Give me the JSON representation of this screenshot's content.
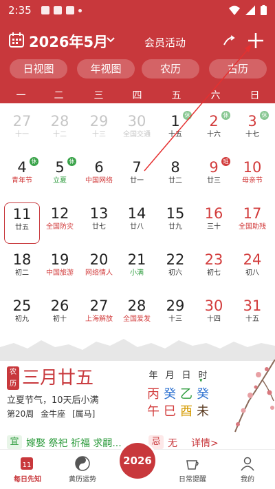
{
  "status_bar": {
    "time": "2:35"
  },
  "header": {
    "month_title": "2026年5月",
    "member_link": "会员活动",
    "view_tabs": [
      "日视图",
      "年视图",
      "农历",
      "古历"
    ],
    "weekdays": [
      "一",
      "二",
      "三",
      "四",
      "五",
      "六",
      "日"
    ]
  },
  "calendar": {
    "weeks": [
      [
        {
          "d": "27",
          "s": "十一",
          "other": true
        },
        {
          "d": "28",
          "s": "十二",
          "other": true
        },
        {
          "d": "29",
          "s": "十三",
          "other": true
        },
        {
          "d": "30",
          "s": "全国交通",
          "other": true
        },
        {
          "d": "1",
          "s": "十五",
          "badge": "休",
          "badgeFaded": true
        },
        {
          "d": "2",
          "s": "十六",
          "badge": "休",
          "badgeFaded": true,
          "weekend": true
        },
        {
          "d": "3",
          "s": "十七",
          "badge": "休",
          "badgeFaded": true,
          "weekend": true
        }
      ],
      [
        {
          "d": "4",
          "s": "青年节",
          "badge": "休",
          "fest": true
        },
        {
          "d": "5",
          "s": "立夏",
          "badge": "休",
          "term": true
        },
        {
          "d": "6",
          "s": "中国网络",
          "fest": true
        },
        {
          "d": "7",
          "s": "廿一"
        },
        {
          "d": "8",
          "s": "廿二"
        },
        {
          "d": "9",
          "s": "廿三",
          "badge": "班",
          "badgeRed": true,
          "weekend": true
        },
        {
          "d": "10",
          "s": "母亲节",
          "fest": true,
          "weekend": true
        }
      ],
      [
        {
          "d": "11",
          "s": "廿五",
          "today": true
        },
        {
          "d": "12",
          "s": "全国防灾",
          "fest": true
        },
        {
          "d": "13",
          "s": "廿七"
        },
        {
          "d": "14",
          "s": "廿八"
        },
        {
          "d": "15",
          "s": "廿九"
        },
        {
          "d": "16",
          "s": "三十",
          "weekend": true
        },
        {
          "d": "17",
          "s": "全国助残",
          "fest": true,
          "weekend": true
        }
      ],
      [
        {
          "d": "18",
          "s": "初二"
        },
        {
          "d": "19",
          "s": "中国旅游",
          "fest": true
        },
        {
          "d": "20",
          "s": "网络情人",
          "fest": true
        },
        {
          "d": "21",
          "s": "小满",
          "term": true
        },
        {
          "d": "22",
          "s": "初六"
        },
        {
          "d": "23",
          "s": "初七",
          "weekend": true
        },
        {
          "d": "24",
          "s": "初八",
          "weekend": true
        }
      ],
      [
        {
          "d": "25",
          "s": "初九"
        },
        {
          "d": "26",
          "s": "初十"
        },
        {
          "d": "27",
          "s": "上海解放",
          "fest": true
        },
        {
          "d": "28",
          "s": "全国爱发",
          "fest": true
        },
        {
          "d": "29",
          "s": "十三"
        },
        {
          "d": "30",
          "s": "十四",
          "weekend": true
        },
        {
          "d": "31",
          "s": "十五",
          "weekend": true
        }
      ]
    ]
  },
  "info": {
    "lunar_tag": "农历",
    "lunar_date": "三月廿五",
    "solar_note": "立夏节气，10天后小满",
    "week_no": "第20周",
    "zodiac_sign": "金牛座",
    "animal": "[属马]",
    "ganzhi_heads": [
      "年",
      "月",
      "日",
      "时"
    ],
    "ganzhi_top": [
      "丙",
      "癸",
      "乙",
      "癸"
    ],
    "ganzhi_bottom": [
      "午",
      "巳",
      "酉",
      "未"
    ],
    "ganzhi_top_colors": [
      "#d23c3c",
      "#2a6fd0",
      "#2a9a3a",
      "#2a6fd0"
    ],
    "ganzhi_bottom_colors": [
      "#d23c3c",
      "#d23c3c",
      "#d49a00",
      "#5a3a20"
    ],
    "yi_label": "宜",
    "yi_text": "嫁娶 祭祀 祈福 求嗣...",
    "ji_label": "忌",
    "ji_text": "无",
    "detail_link": "详情>"
  },
  "bottom_nav": {
    "items": [
      "每日先知",
      "黄历运势",
      "日常提醒",
      "我的"
    ],
    "center_logo": "2026",
    "today_number": "11"
  },
  "colors": {
    "brand": "#c8383c",
    "festival": "#d23c3c",
    "term": "#2a9a3a"
  }
}
